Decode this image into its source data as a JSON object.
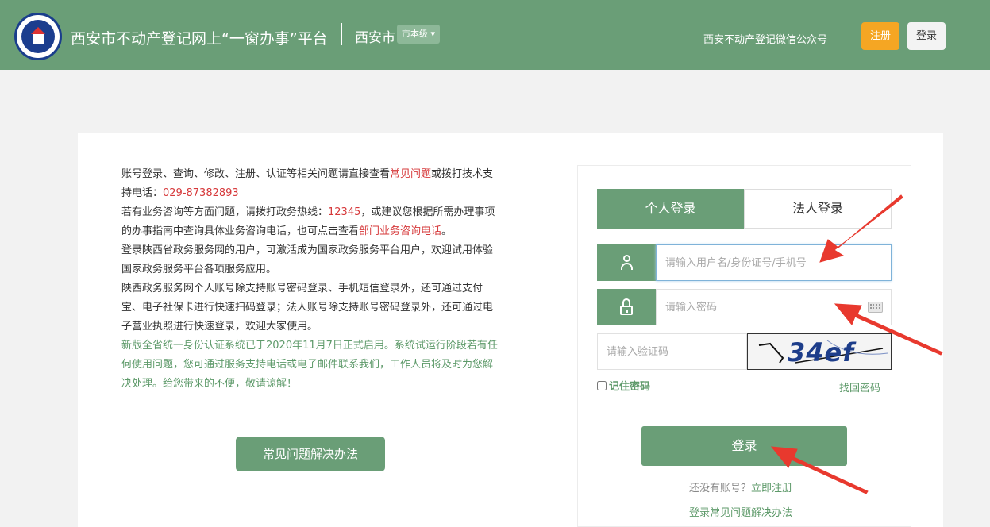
{
  "header": {
    "site_title": "西安市不动产登记网上“一窗办事”平台",
    "city": "西安市",
    "level_select": "市本级",
    "wechat_link": "西安不动产登记微信公众号",
    "register_label": "注册",
    "login_label": "登录",
    "logo_icon": "real-estate-registration-logo",
    "bg_color": "#6a9e77"
  },
  "notice": {
    "p1_a": "账号登录、查询、修改、注册、认证等相关问题请直接查看",
    "p1_link": "常见问题",
    "p1_b": "或拨打技术支持电话：",
    "p1_phone": "029-87382893",
    "p2_a": "若有业务咨询等方面问题，请拨打政务热线：",
    "p2_hotline": "12345",
    "p2_b": "，或建议您根据所需办理事项的办事指南中查询具体业务咨询电话，也可点击查看",
    "p2_link": "部门业务咨询电话",
    "p2_c": "。",
    "p3": "登录陕西省政务服务网的用户，可激活成为国家政务服务平台用户，欢迎试用体验国家政务服务平台各项服务应用。",
    "p4": "陕西政务服务网个人账号除支持账号密码登录、手机短信登录外，还可通过支付宝、电子社保卡进行快速扫码登录；法人账号除支持账号密码登录外，还可通过电子营业执照进行快速登录，欢迎大家使用。",
    "p5": "新版全省统一身份认证系统已于2020年11月7日正式启用。系统试运行阶段若有任何使用问题，您可通过服务支持电话或电子邮件联系我们，工作人员将及时为您解决处理。给您带来的不便，敬请谅解！",
    "faq_button": "常见问题解决办法"
  },
  "login": {
    "tab_personal": "个人登录",
    "tab_legal": "法人登录",
    "username_placeholder": "请输入用户名/身份证号/手机号",
    "password_placeholder": "请输入密码",
    "captcha_placeholder": "请输入验证码",
    "captcha_text": "34ef",
    "remember_label": "记住密码",
    "forgot_label": "找回密码",
    "submit_label": "登录",
    "no_account": "还没有账号？",
    "register_now": "立即注册",
    "faq_link": "登录常见问题解决办法",
    "arrow_color": "#e8392e"
  }
}
